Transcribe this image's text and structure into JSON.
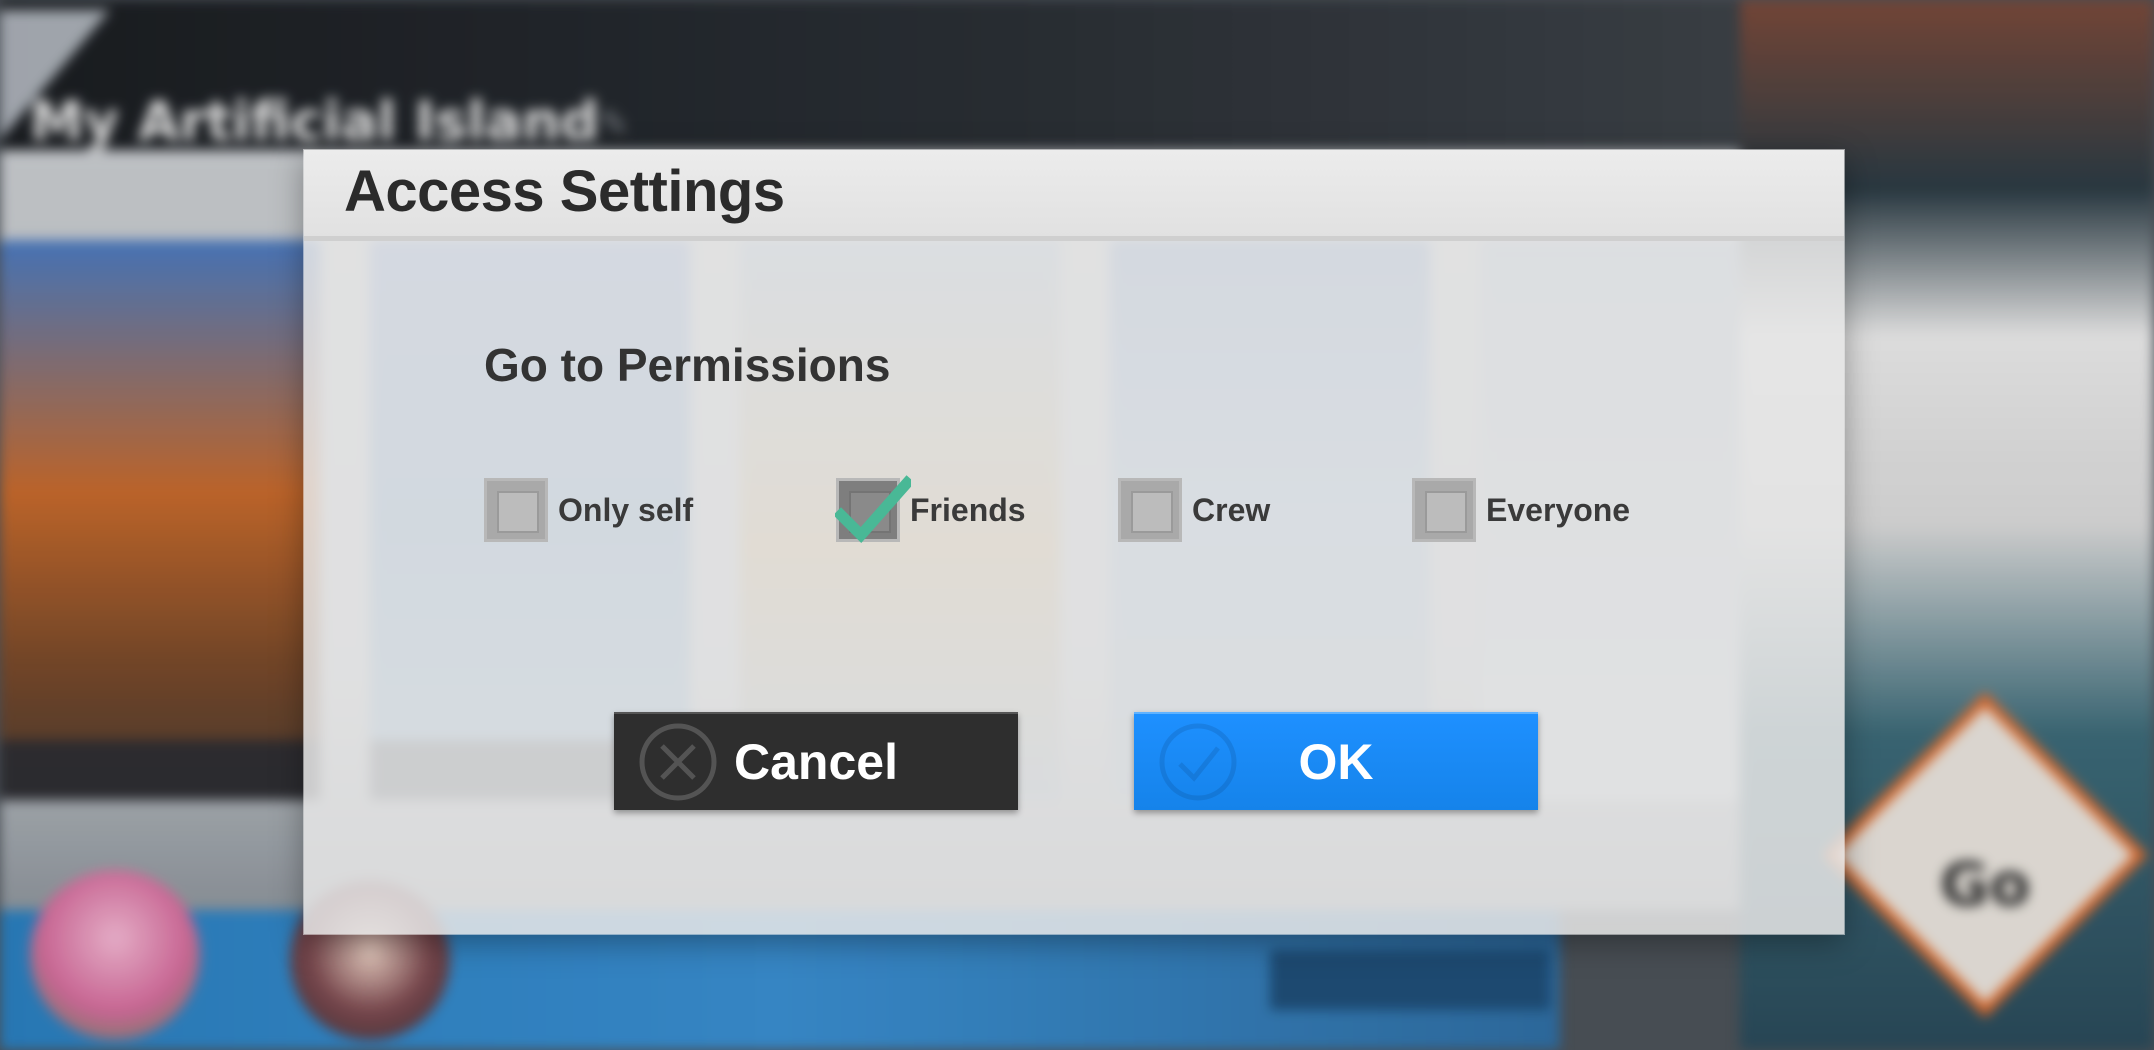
{
  "background": {
    "title": "My Artificial Island",
    "go_label": "Go"
  },
  "dialog": {
    "title": "Access Settings",
    "section_title": "Go to Permissions",
    "options": [
      {
        "label": "Only self",
        "checked": false
      },
      {
        "label": "Friends",
        "checked": true
      },
      {
        "label": "Crew",
        "checked": false
      },
      {
        "label": "Everyone",
        "checked": false
      }
    ],
    "cancel_label": "Cancel",
    "ok_label": "OK"
  },
  "colors": {
    "ok_button": "#1e90ff",
    "cancel_button": "#2e2e2e",
    "checkmark": "#49b896"
  }
}
